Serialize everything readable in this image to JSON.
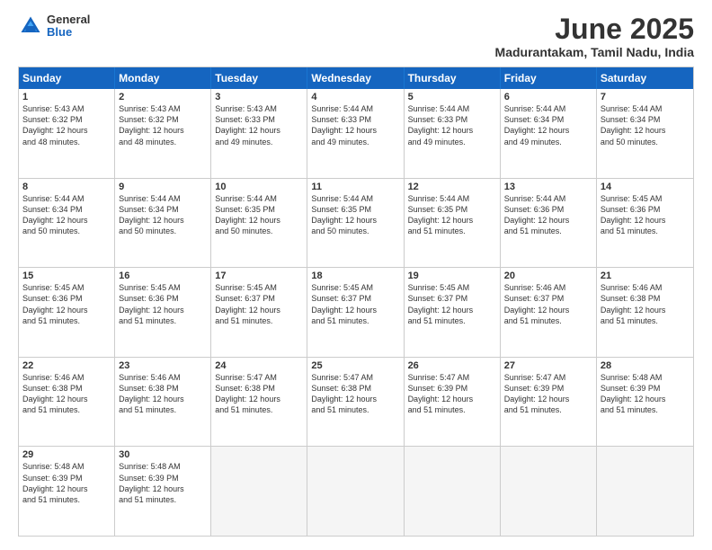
{
  "logo": {
    "general": "General",
    "blue": "Blue"
  },
  "title": "June 2025",
  "location": "Madurantakam, Tamil Nadu, India",
  "days": [
    "Sunday",
    "Monday",
    "Tuesday",
    "Wednesday",
    "Thursday",
    "Friday",
    "Saturday"
  ],
  "rows": [
    [
      {
        "day": "",
        "empty": true
      },
      {
        "day": "2",
        "line1": "Sunrise: 5:43 AM",
        "line2": "Sunset: 6:32 PM",
        "line3": "Daylight: 12 hours",
        "line4": "and 48 minutes."
      },
      {
        "day": "3",
        "line1": "Sunrise: 5:43 AM",
        "line2": "Sunset: 6:33 PM",
        "line3": "Daylight: 12 hours",
        "line4": "and 49 minutes."
      },
      {
        "day": "4",
        "line1": "Sunrise: 5:44 AM",
        "line2": "Sunset: 6:33 PM",
        "line3": "Daylight: 12 hours",
        "line4": "and 49 minutes."
      },
      {
        "day": "5",
        "line1": "Sunrise: 5:44 AM",
        "line2": "Sunset: 6:33 PM",
        "line3": "Daylight: 12 hours",
        "line4": "and 49 minutes."
      },
      {
        "day": "6",
        "line1": "Sunrise: 5:44 AM",
        "line2": "Sunset: 6:34 PM",
        "line3": "Daylight: 12 hours",
        "line4": "and 49 minutes."
      },
      {
        "day": "7",
        "line1": "Sunrise: 5:44 AM",
        "line2": "Sunset: 6:34 PM",
        "line3": "Daylight: 12 hours",
        "line4": "and 50 minutes."
      }
    ],
    [
      {
        "day": "1",
        "line1": "Sunrise: 5:43 AM",
        "line2": "Sunset: 6:32 PM",
        "line3": "Daylight: 12 hours",
        "line4": "and 48 minutes.",
        "first": true
      },
      {
        "day": "9",
        "line1": "Sunrise: 5:44 AM",
        "line2": "Sunset: 6:34 PM",
        "line3": "Daylight: 12 hours",
        "line4": "and 50 minutes."
      },
      {
        "day": "10",
        "line1": "Sunrise: 5:44 AM",
        "line2": "Sunset: 6:35 PM",
        "line3": "Daylight: 12 hours",
        "line4": "and 50 minutes."
      },
      {
        "day": "11",
        "line1": "Sunrise: 5:44 AM",
        "line2": "Sunset: 6:35 PM",
        "line3": "Daylight: 12 hours",
        "line4": "and 50 minutes."
      },
      {
        "day": "12",
        "line1": "Sunrise: 5:44 AM",
        "line2": "Sunset: 6:35 PM",
        "line3": "Daylight: 12 hours",
        "line4": "and 51 minutes."
      },
      {
        "day": "13",
        "line1": "Sunrise: 5:44 AM",
        "line2": "Sunset: 6:36 PM",
        "line3": "Daylight: 12 hours",
        "line4": "and 51 minutes."
      },
      {
        "day": "14",
        "line1": "Sunrise: 5:45 AM",
        "line2": "Sunset: 6:36 PM",
        "line3": "Daylight: 12 hours",
        "line4": "and 51 minutes."
      }
    ],
    [
      {
        "day": "8",
        "line1": "Sunrise: 5:44 AM",
        "line2": "Sunset: 6:34 PM",
        "line3": "Daylight: 12 hours",
        "line4": "and 50 minutes.",
        "row2sun": true
      },
      {
        "day": "16",
        "line1": "Sunrise: 5:45 AM",
        "line2": "Sunset: 6:36 PM",
        "line3": "Daylight: 12 hours",
        "line4": "and 51 minutes."
      },
      {
        "day": "17",
        "line1": "Sunrise: 5:45 AM",
        "line2": "Sunset: 6:37 PM",
        "line3": "Daylight: 12 hours",
        "line4": "and 51 minutes."
      },
      {
        "day": "18",
        "line1": "Sunrise: 5:45 AM",
        "line2": "Sunset: 6:37 PM",
        "line3": "Daylight: 12 hours",
        "line4": "and 51 minutes."
      },
      {
        "day": "19",
        "line1": "Sunrise: 5:45 AM",
        "line2": "Sunset: 6:37 PM",
        "line3": "Daylight: 12 hours",
        "line4": "and 51 minutes."
      },
      {
        "day": "20",
        "line1": "Sunrise: 5:46 AM",
        "line2": "Sunset: 6:37 PM",
        "line3": "Daylight: 12 hours",
        "line4": "and 51 minutes."
      },
      {
        "day": "21",
        "line1": "Sunrise: 5:46 AM",
        "line2": "Sunset: 6:38 PM",
        "line3": "Daylight: 12 hours",
        "line4": "and 51 minutes."
      }
    ],
    [
      {
        "day": "15",
        "line1": "Sunrise: 5:45 AM",
        "line2": "Sunset: 6:36 PM",
        "line3": "Daylight: 12 hours",
        "line4": "and 51 minutes.",
        "row3sun": true
      },
      {
        "day": "23",
        "line1": "Sunrise: 5:46 AM",
        "line2": "Sunset: 6:38 PM",
        "line3": "Daylight: 12 hours",
        "line4": "and 51 minutes."
      },
      {
        "day": "24",
        "line1": "Sunrise: 5:47 AM",
        "line2": "Sunset: 6:38 PM",
        "line3": "Daylight: 12 hours",
        "line4": "and 51 minutes."
      },
      {
        "day": "25",
        "line1": "Sunrise: 5:47 AM",
        "line2": "Sunset: 6:38 PM",
        "line3": "Daylight: 12 hours",
        "line4": "and 51 minutes."
      },
      {
        "day": "26",
        "line1": "Sunrise: 5:47 AM",
        "line2": "Sunset: 6:39 PM",
        "line3": "Daylight: 12 hours",
        "line4": "and 51 minutes."
      },
      {
        "day": "27",
        "line1": "Sunrise: 5:47 AM",
        "line2": "Sunset: 6:39 PM",
        "line3": "Daylight: 12 hours",
        "line4": "and 51 minutes."
      },
      {
        "day": "28",
        "line1": "Sunrise: 5:48 AM",
        "line2": "Sunset: 6:39 PM",
        "line3": "Daylight: 12 hours",
        "line4": "and 51 minutes."
      }
    ],
    [
      {
        "day": "22",
        "line1": "Sunrise: 5:46 AM",
        "line2": "Sunset: 6:38 PM",
        "line3": "Daylight: 12 hours",
        "line4": "and 51 minutes.",
        "row4sun": true
      },
      {
        "day": "30",
        "line1": "Sunrise: 5:48 AM",
        "line2": "Sunset: 6:39 PM",
        "line3": "Daylight: 12 hours",
        "line4": "and 51 minutes."
      },
      {
        "day": "",
        "empty": true
      },
      {
        "day": "",
        "empty": true
      },
      {
        "day": "",
        "empty": true
      },
      {
        "day": "",
        "empty": true
      },
      {
        "day": "",
        "empty": true
      }
    ]
  ],
  "row5": [
    {
      "day": "29",
      "line1": "Sunrise: 5:48 AM",
      "line2": "Sunset: 6:39 PM",
      "line3": "Daylight: 12 hours",
      "line4": "and 51 minutes."
    },
    {
      "day": "30",
      "line1": "Sunrise: 5:48 AM",
      "line2": "Sunset: 6:39 PM",
      "line3": "Daylight: 12 hours",
      "line4": "and 51 minutes."
    }
  ]
}
